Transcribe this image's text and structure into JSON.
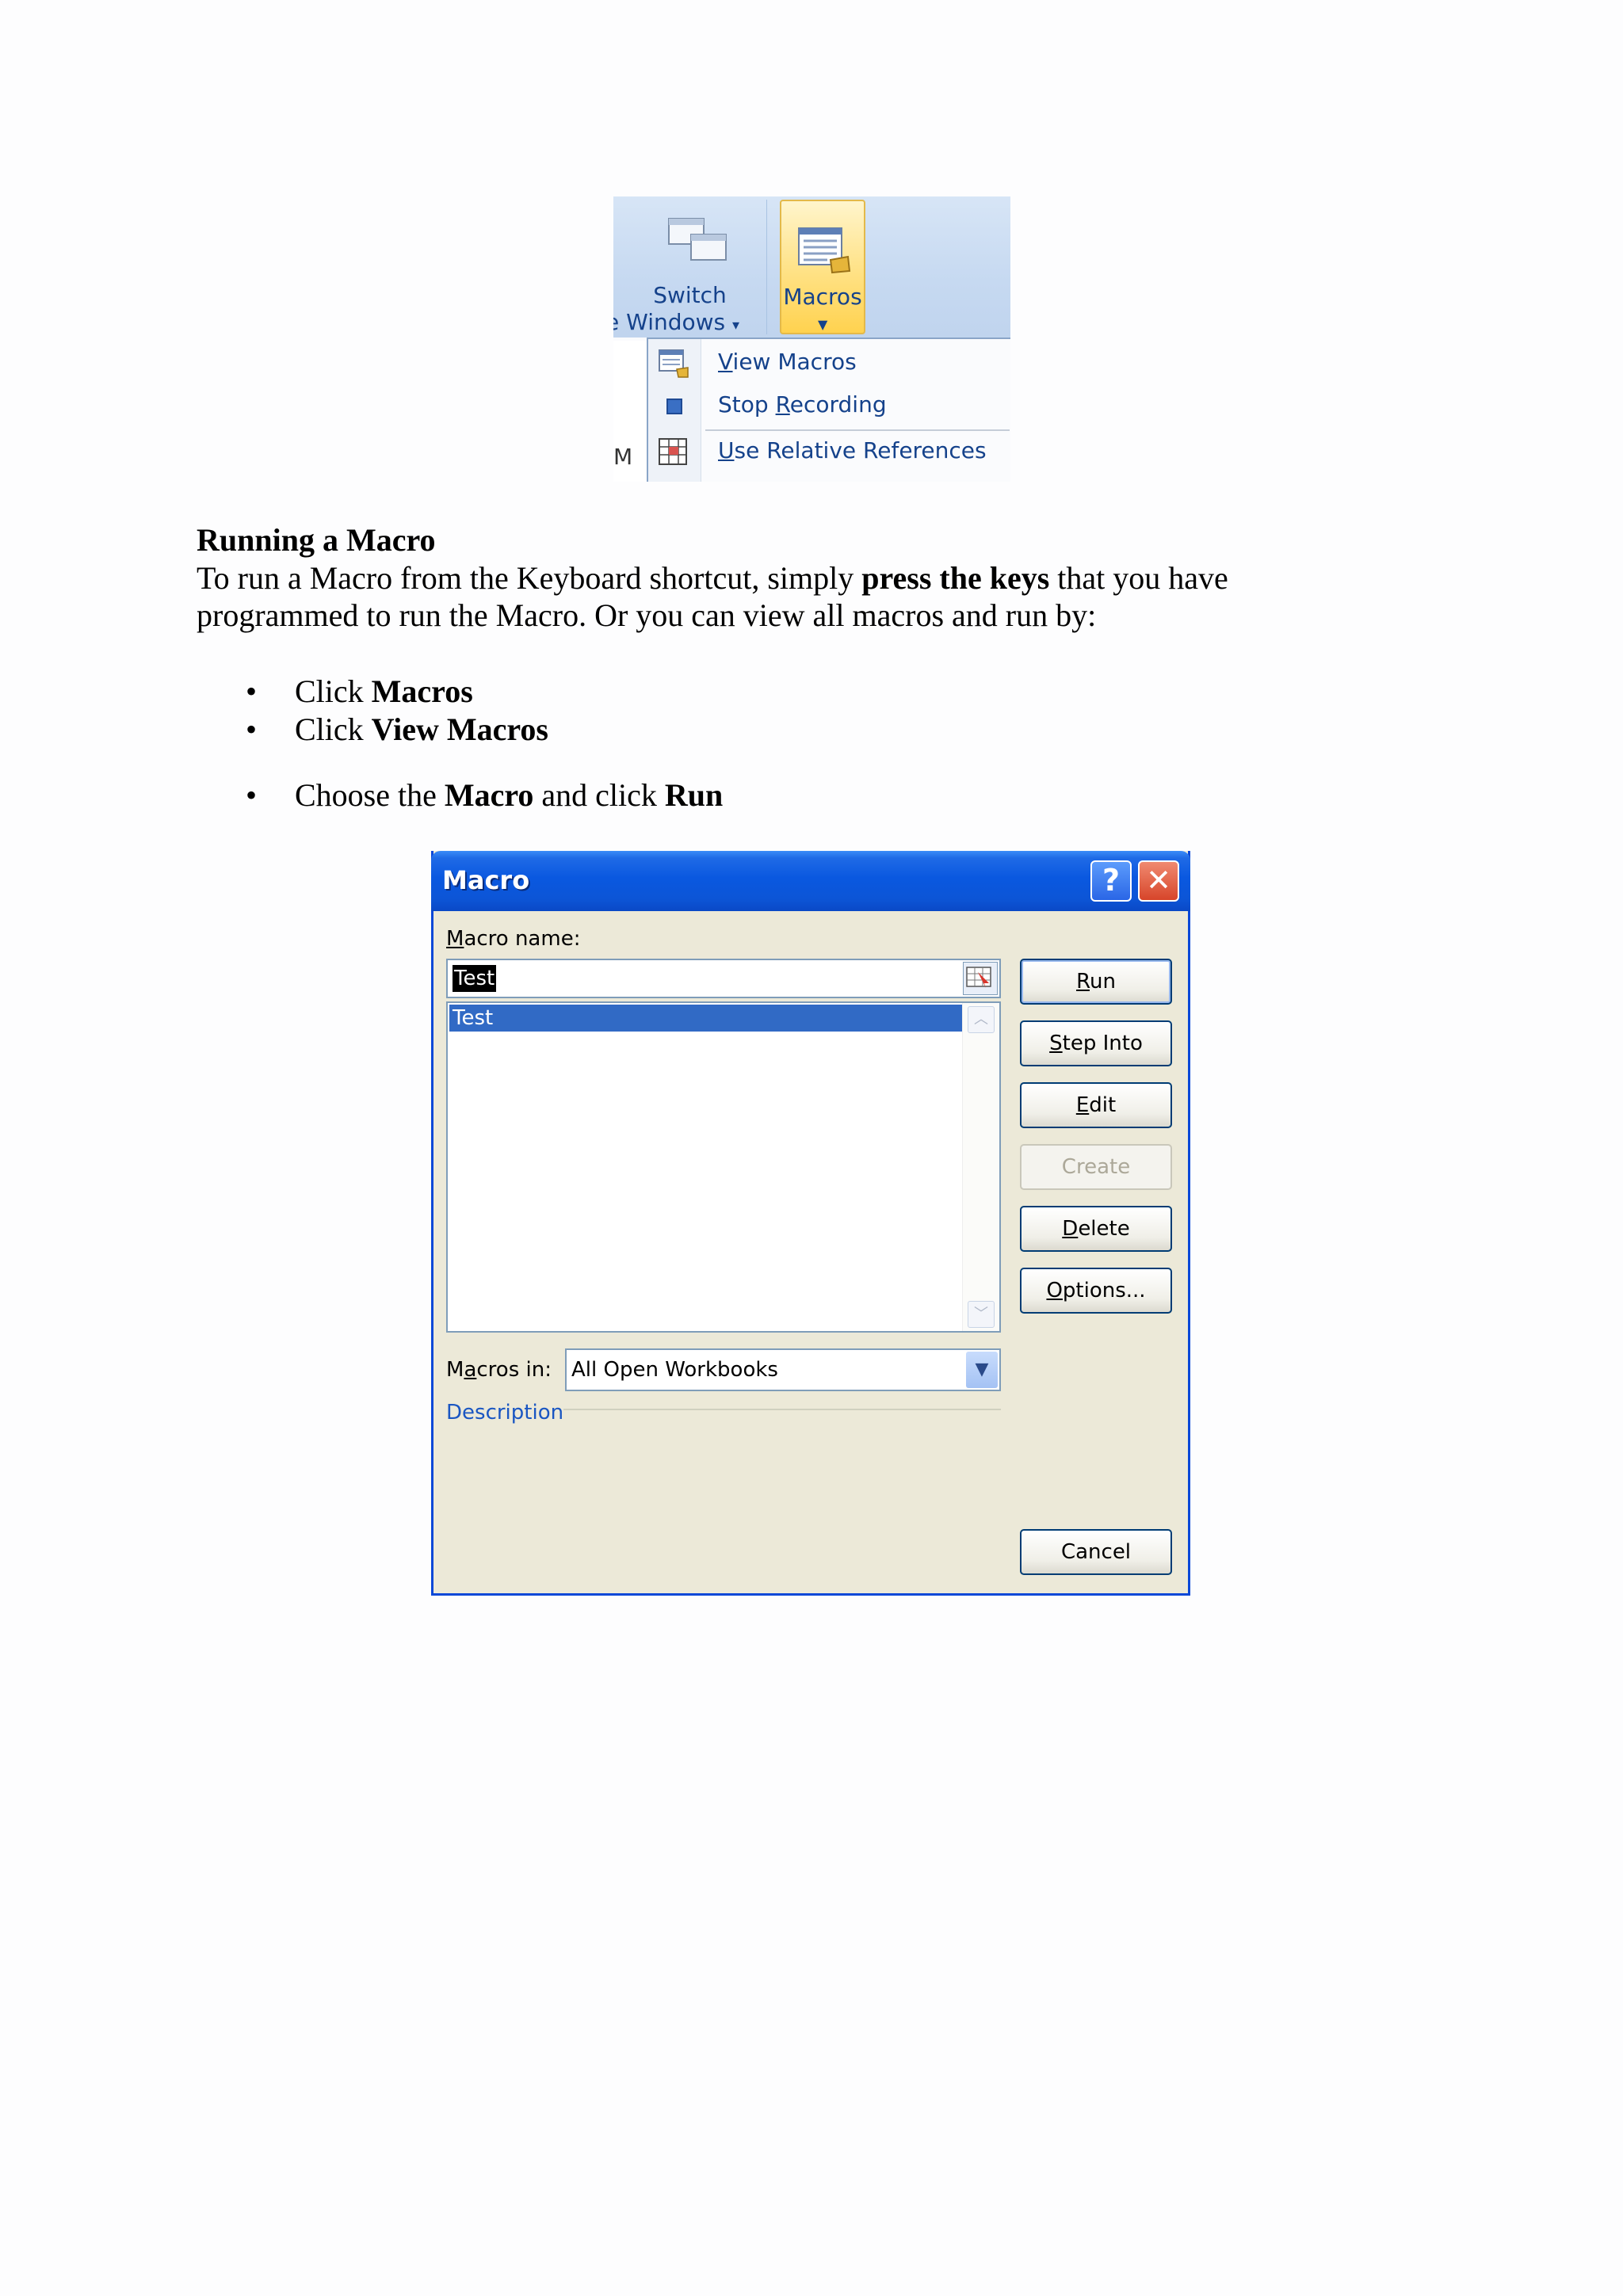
{
  "ribbon": {
    "switch_label1": "Switch",
    "switch_label2": "e  Windows",
    "switch_arrow": "▾",
    "macros_label": "Macros",
    "macros_arrow": "▼",
    "left_cell_text": "M",
    "menu": [
      {
        "prefix": "V",
        "rest": "iew Macros",
        "icon": "view-macros-icon"
      },
      {
        "prefix": "Stop ",
        "ul": "R",
        "rest": "ecording",
        "icon": "stop-recording-icon"
      },
      {
        "prefix": "U",
        "rest": "se Relative References",
        "icon": "relative-references-icon"
      }
    ]
  },
  "doc": {
    "heading": "Running a Macro",
    "para1_a": "To run a Macro from the Keyboard shortcut, simply ",
    "para1_b": "press the keys",
    "para1_c": " that you have",
    "para2": "programmed to run the Macro.  Or you can view all macros and run by:",
    "bullets": [
      {
        "pre": "Click ",
        "bold": "Macros",
        "mid": "",
        "bold2": ""
      },
      {
        "pre": "Click ",
        "bold": "View Macros",
        "mid": "",
        "bold2": ""
      },
      {
        "pre": "Choose the ",
        "bold": "Macro",
        "mid": " and click ",
        "bold2": "Run"
      }
    ]
  },
  "dialog": {
    "title": "Macro",
    "help": "?",
    "close": "✕",
    "macro_name_label_u": "M",
    "macro_name_label_rest": "acro name:",
    "macro_name_value": "Test",
    "list_items": [
      "Test"
    ],
    "buttons": {
      "run": {
        "u": "R",
        "rest": "un"
      },
      "step_into": {
        "u": "S",
        "rest": "tep Into"
      },
      "edit": {
        "u": "E",
        "rest": "dit"
      },
      "create": "Create",
      "delete": {
        "u": "D",
        "rest": "elete"
      },
      "options": {
        "u": "O",
        "rest": "ptions..."
      },
      "cancel": "Cancel"
    },
    "macros_in_label_pre": "M",
    "macros_in_label_u": "a",
    "macros_in_label_rest": "cros in:",
    "macros_in_value": "All Open Workbooks",
    "description_label": "Description"
  }
}
